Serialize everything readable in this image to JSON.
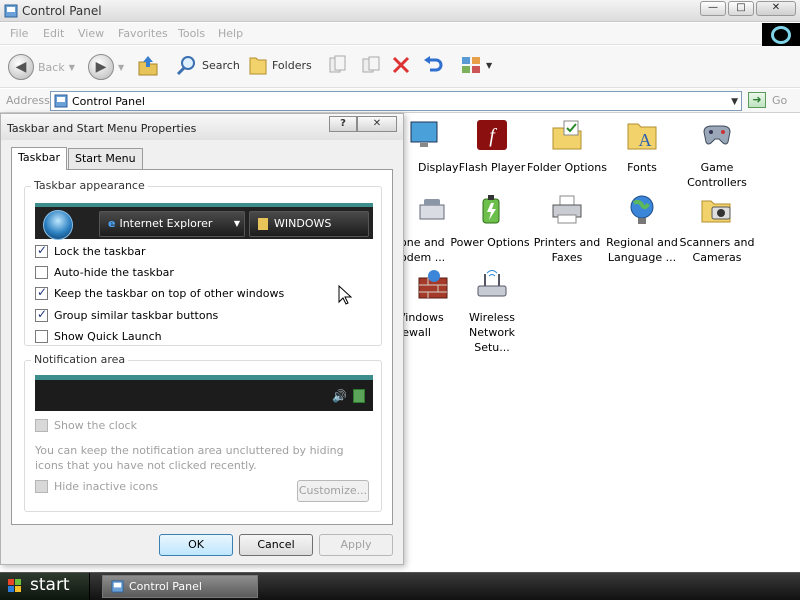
{
  "window": {
    "title": "Control Panel",
    "controls": {
      "minimize": "—",
      "maximize": "□",
      "close": "✕"
    }
  },
  "menu": [
    "File",
    "Edit",
    "View",
    "Favorites",
    "Tools",
    "Help"
  ],
  "toolbar": {
    "back": "Back",
    "search": "Search",
    "folders": "Folders"
  },
  "address": {
    "label": "Address",
    "value": "Control Panel",
    "go": "Go"
  },
  "items": [
    {
      "label": "Display",
      "icon": "display-icon"
    },
    {
      "label": "Flash Player",
      "icon": "flash-player-icon"
    },
    {
      "label": "Folder Options",
      "icon": "folder-options-icon"
    },
    {
      "label": "Fonts",
      "icon": "fonts-icon"
    },
    {
      "label": "Game Controllers",
      "icon": "game-controllers-icon"
    },
    {
      "label": "one and odem ...",
      "icon": "phone-modem-icon"
    },
    {
      "label": "Power Options",
      "icon": "power-options-icon"
    },
    {
      "label": "Printers and Faxes",
      "icon": "printers-faxes-icon"
    },
    {
      "label": "Regional and Language ...",
      "icon": "regional-language-icon"
    },
    {
      "label": "Scanners and Cameras",
      "icon": "scanners-cameras-icon"
    },
    {
      "label": "Vindows rewall",
      "icon": "windows-firewall-icon"
    },
    {
      "label": "Wireless Network Setu...",
      "icon": "wireless-network-icon"
    }
  ],
  "dialog": {
    "title": "Taskbar and Start Menu Properties",
    "help": "?",
    "close": "✕",
    "tabs": [
      "Taskbar",
      "Start Menu"
    ],
    "appearance": {
      "label": "Taskbar appearance",
      "preview_ie": "Internet Explorer",
      "preview_folder": "WINDOWS",
      "options": [
        {
          "label": "Lock the taskbar",
          "checked": true
        },
        {
          "label": "Auto-hide the taskbar",
          "checked": false
        },
        {
          "label": "Keep the taskbar on top of other windows",
          "checked": true
        },
        {
          "label": "Group similar taskbar buttons",
          "checked": true
        },
        {
          "label": "Show Quick Launch",
          "checked": false
        }
      ]
    },
    "notification": {
      "label": "Notification area",
      "show_clock": "Show the clock",
      "hint": "You can keep the notification area uncluttered by hiding icons that you have not clicked recently.",
      "hide_inactive": "Hide inactive icons",
      "customize": "Customize..."
    },
    "buttons": {
      "ok": "OK",
      "cancel": "Cancel",
      "apply": "Apply"
    }
  },
  "taskbar": {
    "start": "start",
    "task": "Control Panel"
  }
}
